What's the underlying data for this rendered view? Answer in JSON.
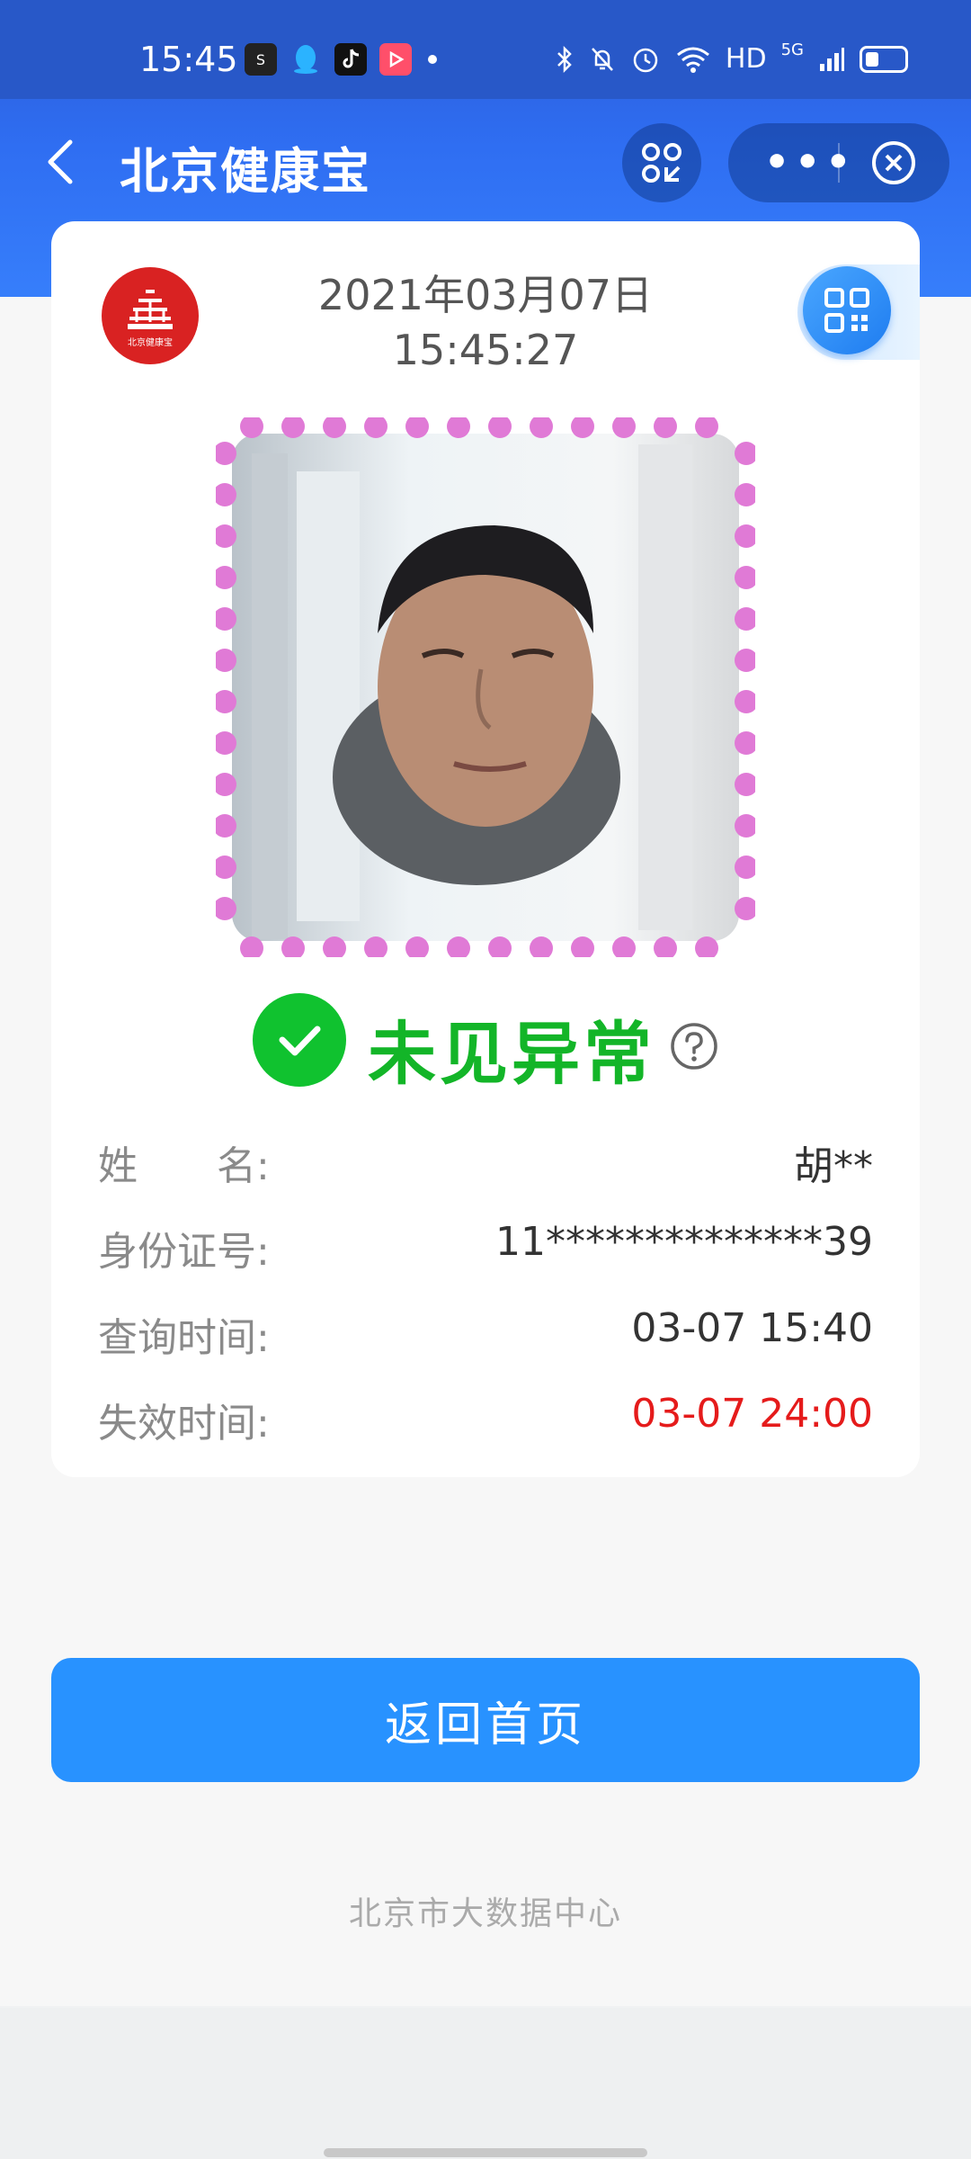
{
  "status_bar": {
    "time": "15:45",
    "apps": [
      "soul-app-icon",
      "qq-icon",
      "tiktok-icon",
      "video-app-icon"
    ],
    "right_icons": [
      "bluetooth-icon",
      "mute-icon",
      "alarm-icon",
      "wifi-icon"
    ],
    "hd": "HD",
    "network": "5G"
  },
  "nav": {
    "title": "北京健康宝"
  },
  "card": {
    "date": "2021年03月07日",
    "time": "15:45:27",
    "logo_text": "北京健康宝",
    "status": "未见异常",
    "rows": [
      {
        "label": "姓　　名:",
        "value": "胡**"
      },
      {
        "label": "身份证号:",
        "value": "11**************39"
      },
      {
        "label": "查询时间:",
        "value": "03-07 15:40"
      },
      {
        "label": "失效时间:",
        "value": "03-07 24:00"
      }
    ]
  },
  "colors": {
    "primary": "#2892ff",
    "ok_green": "#13b528",
    "expire_red": "#e51b1b",
    "photo_frame_dot": "#e07ad6"
  },
  "home_button": "返回首页",
  "footer": "北京市大数据中心"
}
